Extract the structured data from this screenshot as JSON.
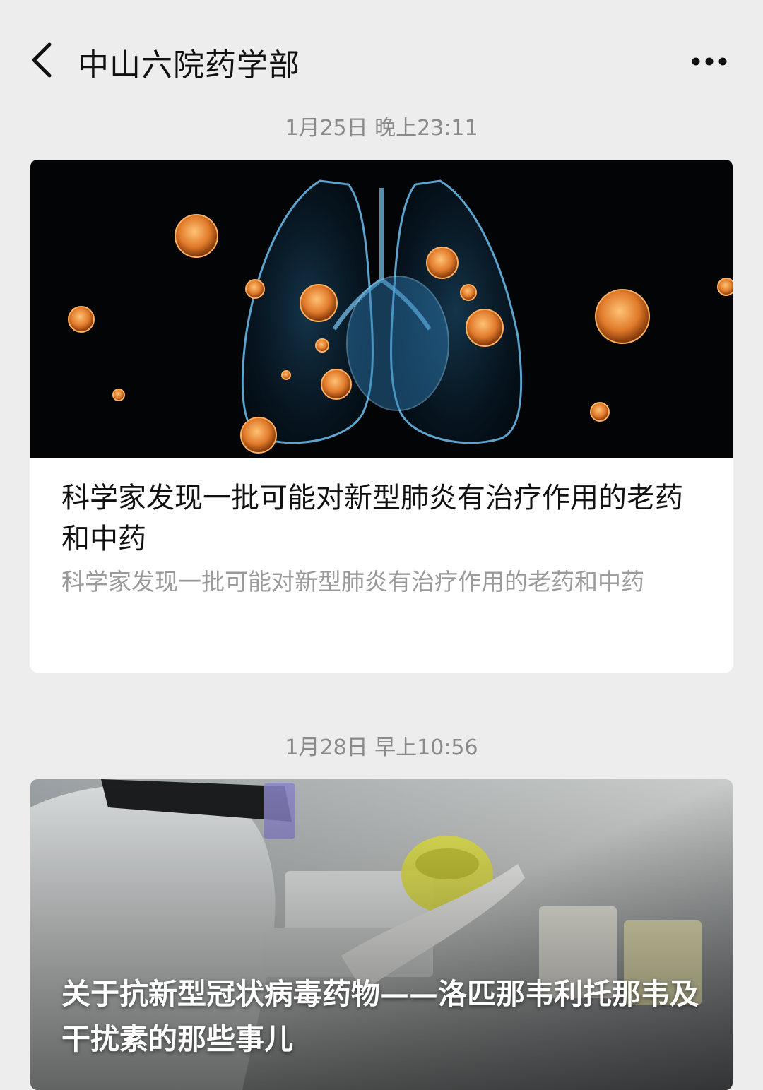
{
  "header": {
    "title": "中山六院药学部",
    "back_icon": "chevron-left-icon",
    "more_icon": "more-dots-icon"
  },
  "messages": [
    {
      "timestamp": "1月25日 晚上23:11",
      "cover": "lungs-virus-image",
      "title": "科学家发现一批可能对新型肺炎有治疗作用的老药和中药",
      "description": "科学家发现一批可能对新型肺炎有治疗作用的老药和中药"
    },
    {
      "timestamp": "1月28日 早上10:56",
      "cover": "lab-researcher-image",
      "title": "关于抗新型冠状病毒药物——洛匹那韦利托那韦及干扰素的那些事儿"
    }
  ],
  "colors": {
    "background": "#ededed",
    "card": "#ffffff",
    "timestamp": "#8a8a8a",
    "virus": "#e07a2a",
    "lung": "#4fa3d6"
  }
}
